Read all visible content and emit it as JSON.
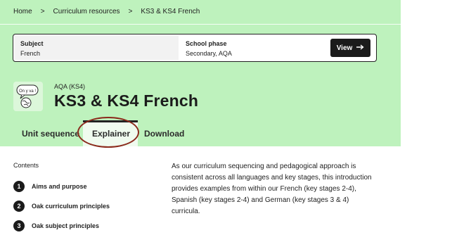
{
  "breadcrumb": {
    "items": [
      "Home",
      "Curriculum resources",
      "KS3 & KS4 French"
    ],
    "separator": ">"
  },
  "selector": {
    "subject_label": "Subject",
    "subject_value": "French",
    "phase_label": "School phase",
    "phase_value": "Secondary, AQA",
    "view_label": "View",
    "view_icon": "arrow-right-icon"
  },
  "header": {
    "exam_board": "AQA (KS4)",
    "title": "KS3 & KS4 French",
    "logo_text": "On y va !"
  },
  "tabs": [
    "Unit sequence",
    "Explainer",
    "Download"
  ],
  "active_tab": "Explainer",
  "contents": {
    "heading": "Contents",
    "items": [
      {
        "number": "1",
        "label": "Aims and purpose"
      },
      {
        "number": "2",
        "label": "Oak curriculum principles"
      },
      {
        "number": "3",
        "label": "Oak subject principles"
      }
    ]
  },
  "intro": {
    "text": "As our curriculum sequencing and pedagogical approach is consistent across all languages and key stages, this introduction provides examples from within our French (key stages 2-4), Spanish (key stages 2-4) and German (key stages 3 & 4) curricula."
  },
  "colors": {
    "brand_green": "#bef2bd",
    "button_dark": "#1b1b1b",
    "focus_ring": "#8b2a1c"
  }
}
